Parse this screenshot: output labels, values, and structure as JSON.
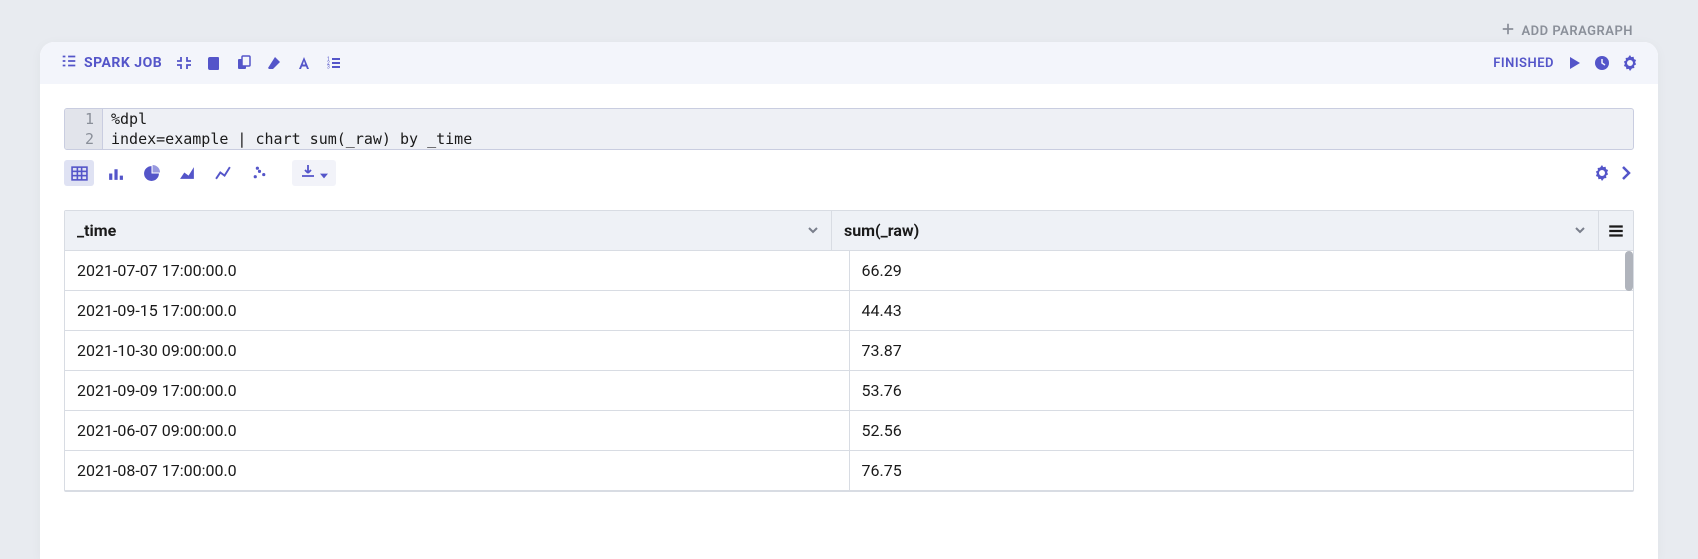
{
  "buttons": {
    "add_paragraph": "ADD PARAGRAPH"
  },
  "header": {
    "spark_job": "SPARK JOB",
    "status": "FINISHED"
  },
  "code": {
    "lines": [
      {
        "n": "1",
        "text": "%dpl"
      },
      {
        "n": "2",
        "text": "index=example | chart sum(_raw) by _time"
      }
    ]
  },
  "table": {
    "columns": [
      "_time",
      "sum(_raw)"
    ],
    "rows": [
      [
        "2021-07-07 17:00:00.0",
        "66.29"
      ],
      [
        "2021-09-15 17:00:00.0",
        "44.43"
      ],
      [
        "2021-10-30 09:00:00.0",
        "73.87"
      ],
      [
        "2021-09-09 17:00:00.0",
        "53.76"
      ],
      [
        "2021-06-07 09:00:00.0",
        "52.56"
      ],
      [
        "2021-08-07 17:00:00.0",
        "76.75"
      ]
    ]
  }
}
